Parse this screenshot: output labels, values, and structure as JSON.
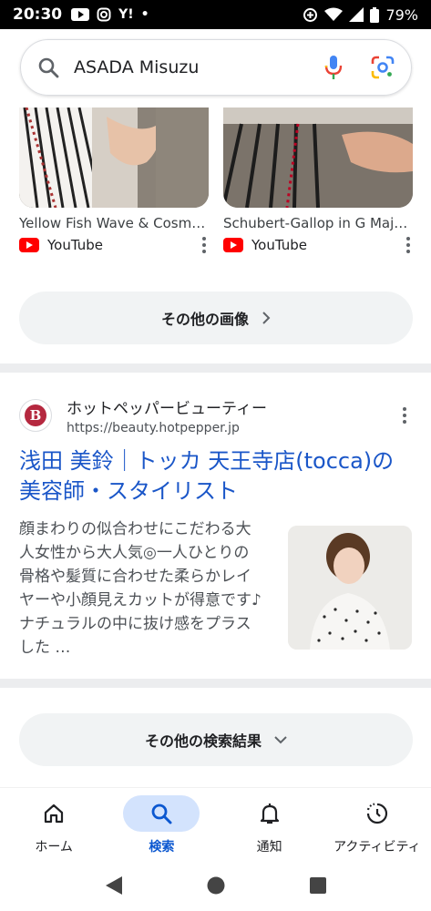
{
  "status": {
    "time": "20:30",
    "battery": "79%"
  },
  "search": {
    "query": "ASADA Misuzu"
  },
  "images": [
    {
      "caption": "Yellow Fish Wave & Cosm…",
      "source": "YouTube"
    },
    {
      "caption": "Schubert-Gallop in G Majo…",
      "source": "YouTube"
    }
  ],
  "more_images_label": "その他の画像",
  "result": {
    "site_name": "ホットペッパービューティー",
    "url": "https://beauty.hotpepper.jp",
    "favicon_letter": "B",
    "title": "浅田 美鈴｜トッカ 天王寺店(tocca)の美容師・スタイリスト",
    "snippet": "顔まわりの似合わせにこだわる大人女性から大人気◎一人ひとりの骨格や髪質に合わせた柔らかレイヤーや小顔見えカットが得意です♪ナチュラルの中に抜け感をプラスした …"
  },
  "more_results_label": "その他の検索結果",
  "bottom_nav": [
    {
      "label": "ホーム",
      "icon": "home-icon",
      "active": false
    },
    {
      "label": "検索",
      "icon": "search-icon",
      "active": true
    },
    {
      "label": "通知",
      "icon": "bell-icon",
      "active": false
    },
    {
      "label": "アクティビティ",
      "icon": "activity-icon",
      "active": false
    }
  ],
  "colors": {
    "link": "#1a56c8",
    "active_nav": "#0b57d0",
    "active_nav_bg": "#d3e3fd",
    "youtube": "#ff0000"
  }
}
